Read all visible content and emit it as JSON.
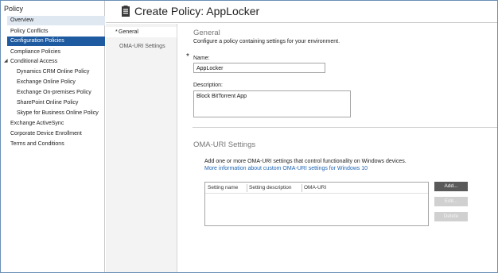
{
  "left_nav": {
    "title": "Policy",
    "items": [
      {
        "label": "Overview"
      },
      {
        "label": "Policy Conflicts"
      },
      {
        "label": "Configuration Policies"
      },
      {
        "label": "Compliance Policies"
      },
      {
        "label": "Conditional Access"
      },
      {
        "label": "Dynamics CRM Online Policy"
      },
      {
        "label": "Exchange Online Policy"
      },
      {
        "label": "Exchange On-premises Policy"
      },
      {
        "label": "SharePoint Online Policy"
      },
      {
        "label": "Skype for Business Online Policy"
      },
      {
        "label": "Exchange ActiveSync"
      },
      {
        "label": "Corporate Device Enrollment"
      },
      {
        "label": "Terms and Conditions"
      }
    ]
  },
  "header": {
    "title": "Create Policy: AppLocker",
    "icon": "policy-document-icon"
  },
  "steps": [
    {
      "label": "General",
      "marker": "*"
    },
    {
      "label": "OMA-URI Settings"
    }
  ],
  "general": {
    "title": "General",
    "description": "Configure a policy containing settings for your environment.",
    "required_marker": "*",
    "name_label": "Name:",
    "name_value": "AppLocker",
    "description_label": "Description:",
    "description_value": "Block BitTorrent App"
  },
  "oma": {
    "title": "OMA-URI Settings",
    "description": "Add one or more OMA-URI settings that control functionality on Windows devices.",
    "link": "More information about custom OMA-URI settings for Windows 10",
    "columns": [
      "Setting name",
      "Setting description",
      "OMA-URI"
    ],
    "buttons": {
      "add": "Add...",
      "edit": "Edit...",
      "delete": "Delete"
    }
  },
  "colors": {
    "selected_item": "#1e5aa0",
    "hover_item": "#dfe7f1",
    "link": "#1e64b4",
    "button_primary": "#595959",
    "button_disabled": "#d0d0d0"
  }
}
